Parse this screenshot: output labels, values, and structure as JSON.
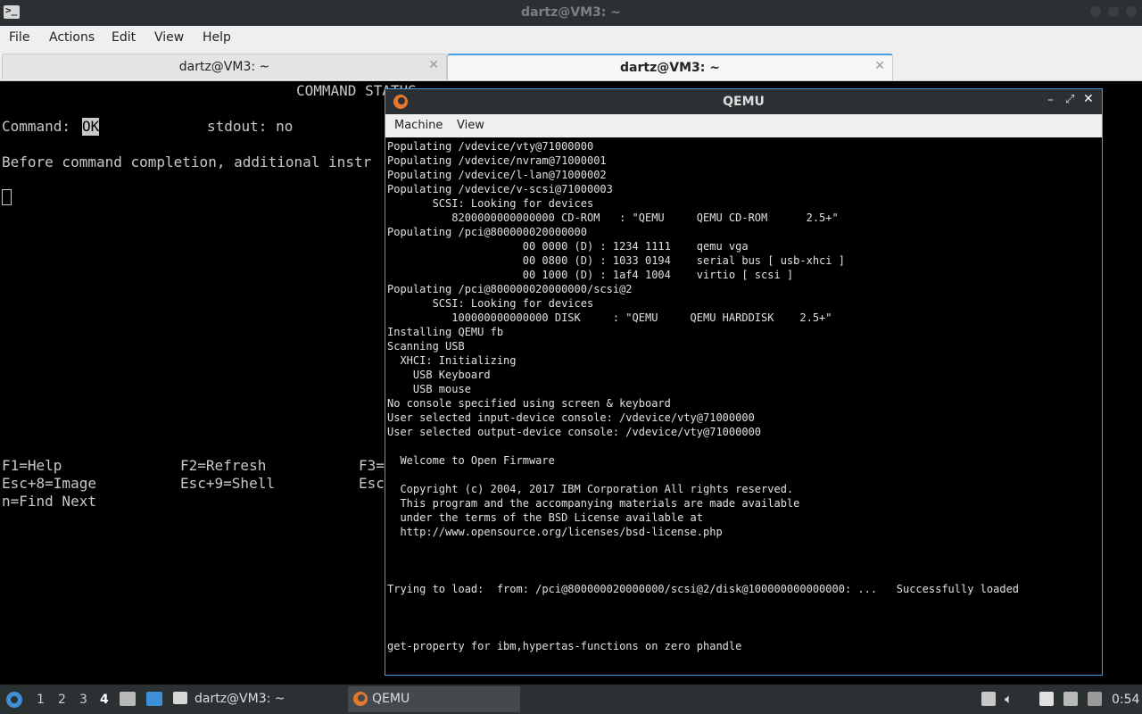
{
  "window": {
    "title": "dartz@VM3: ~",
    "terminal_glyph": ">_"
  },
  "menubar": {
    "items": [
      "File",
      "Actions",
      "Edit",
      "View",
      "Help"
    ]
  },
  "tabs": [
    {
      "label": "dartz@VM3: ~",
      "active": false
    },
    {
      "label": "dartz@VM3: ~",
      "active": true
    }
  ],
  "terminal": {
    "header": "COMMAND STATUS",
    "command_label": "Command:",
    "command_value": "OK",
    "stdout_text": "stdout: no",
    "note": "Before command completion, additional instr",
    "fkeys": [
      [
        "F1=Help",
        "F2=Refresh",
        "F3="
      ],
      [
        "Esc+8=Image",
        "Esc+9=Shell",
        "Esc"
      ],
      [
        "n=Find Next",
        "",
        ""
      ]
    ]
  },
  "qemu": {
    "title": "QEMU",
    "menu": [
      "Machine",
      "View"
    ],
    "console_lines": [
      "Populating /vdevice/vty@71000000",
      "Populating /vdevice/nvram@71000001",
      "Populating /vdevice/l-lan@71000002",
      "Populating /vdevice/v-scsi@71000003",
      "       SCSI: Looking for devices",
      "          8200000000000000 CD-ROM   : \"QEMU     QEMU CD-ROM      2.5+\"",
      "Populating /pci@800000020000000",
      "                     00 0000 (D) : 1234 1111    qemu vga",
      "                     00 0800 (D) : 1033 0194    serial bus [ usb-xhci ]",
      "                     00 1000 (D) : 1af4 1004    virtio [ scsi ]",
      "Populating /pci@800000020000000/scsi@2",
      "       SCSI: Looking for devices",
      "          100000000000000 DISK     : \"QEMU     QEMU HARDDISK    2.5+\"",
      "Installing QEMU fb",
      "Scanning USB",
      "  XHCI: Initializing",
      "    USB Keyboard",
      "    USB mouse",
      "No console specified using screen & keyboard",
      "User selected input-device console: /vdevice/vty@71000000",
      "User selected output-device console: /vdevice/vty@71000000",
      "",
      "  Welcome to Open Firmware",
      "",
      "  Copyright (c) 2004, 2017 IBM Corporation All rights reserved.",
      "  This program and the accompanying materials are made available",
      "  under the terms of the BSD License available at",
      "  http://www.opensource.org/licenses/bsd-license.php",
      "",
      "",
      "",
      "Trying to load:  from: /pci@800000020000000/scsi@2/disk@100000000000000: ...   Successfully loaded",
      "",
      "",
      "",
      "get-property for ibm,hypertas-functions on zero phandle"
    ]
  },
  "taskbar": {
    "workspaces": [
      "1",
      "2",
      "3",
      "4"
    ],
    "current_workspace": "4",
    "tasks": [
      {
        "label": "dartz@VM3: ~"
      },
      {
        "label": "QEMU"
      }
    ],
    "clock": "0:54"
  },
  "colors": {
    "accent": "#4b9fe5",
    "titlebar": "#2b3033",
    "terminal_fg": "#c8c8c8"
  }
}
